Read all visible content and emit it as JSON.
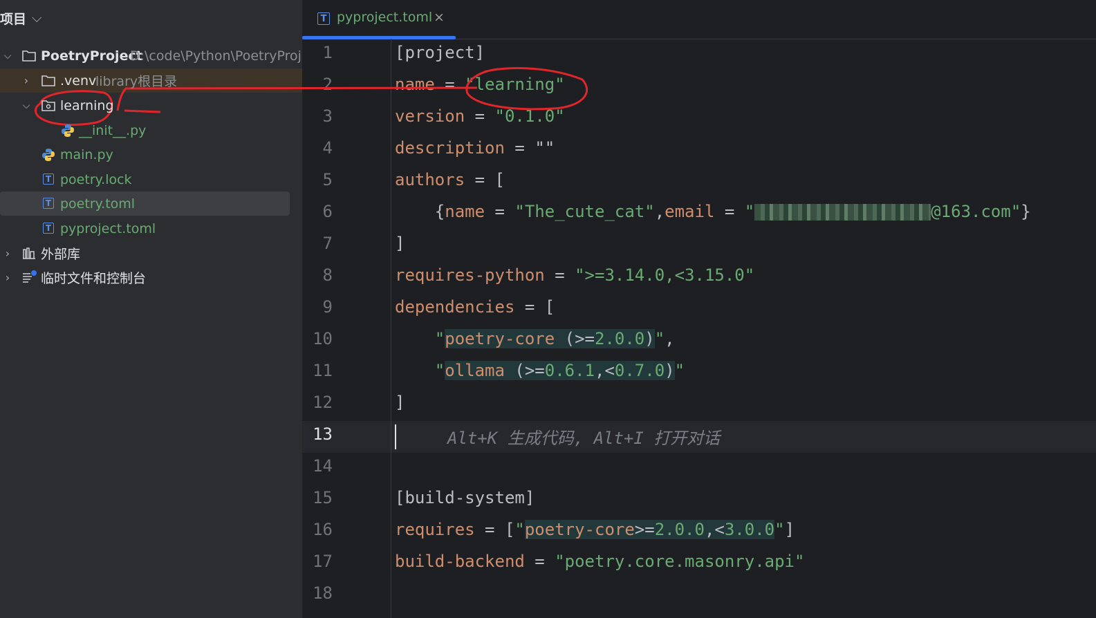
{
  "panel": {
    "title": "项目",
    "items": [
      {
        "label": "PoetryProject",
        "hint": "D:\\code\\Python\\PoetryProjec"
      },
      {
        "label": ".venv",
        "hint": "library根目录"
      },
      {
        "label": "learning"
      },
      {
        "label": "__init__.py"
      },
      {
        "label": "main.py"
      },
      {
        "label": "poetry.lock"
      },
      {
        "label": "poetry.toml"
      },
      {
        "label": "pyproject.toml"
      },
      {
        "label": "外部库"
      },
      {
        "label": "临时文件和控制台"
      }
    ]
  },
  "tab": {
    "label": "pyproject.toml",
    "close": "×"
  },
  "editor": {
    "line_numbers": [
      "1",
      "2",
      "3",
      "4",
      "5",
      "6",
      "7",
      "8",
      "9",
      "10",
      "11",
      "12",
      "13",
      "14",
      "15",
      "16",
      "17",
      "18"
    ],
    "active_line": "13",
    "lines": {
      "l1": {
        "a": "[project]"
      },
      "l2": {
        "k": "name",
        "op": " = ",
        "s": "\"learning\""
      },
      "l3": {
        "k": "version",
        "op": " = ",
        "s": "\"0.1.0\""
      },
      "l4": {
        "k": "description",
        "op": " = ",
        "s": "\"\""
      },
      "l5": {
        "k": "authors",
        "op": " = ["
      },
      "l6": {
        "p1": "    {",
        "k1": "name",
        "op1": " = ",
        "s1": "\"The_cute_cat\"",
        "p2": ",",
        "k2": "email",
        "op2": " = ",
        "s2a": "\"",
        "s2b": "@163.com\"",
        "p3": "}"
      },
      "l7": {
        "a": "]"
      },
      "l8": {
        "k": "requires-python",
        "op": " = ",
        "s": "\">=3.14.0,<3.15.0\""
      },
      "l9": {
        "k": "dependencies",
        "op": " = ["
      },
      "l10": {
        "p1": "    ",
        "q1": "\"",
        "k": "poetry-core",
        "t": " (>=",
        "n": "2.0.0",
        "t2": ")",
        "q2": "\"",
        "p2": ","
      },
      "l11": {
        "p1": "    ",
        "q1": "\"",
        "k": "ollama",
        "t": " (>=",
        "n": "0.6.1",
        "t3": ",<",
        "n2": "0.7.0",
        "t2": ")",
        "q2": "\""
      },
      "l12": {
        "a": "]"
      },
      "l13": {
        "ghost": "Alt+K 生成代码, Alt+I 打开对话"
      },
      "l15": {
        "a": "[build-system]"
      },
      "l16": {
        "k": "requires",
        "op": " = [",
        "q1": "\"",
        "k2": "poetry-core",
        "t": ">=",
        "n": "2.0.0",
        "t2": ",<",
        "n2": "3.0.0",
        "q2": "\"",
        "p": "]"
      },
      "l17": {
        "k": "build-backend",
        "op": " = ",
        "s": "\"poetry.core.masonry.api\""
      }
    }
  },
  "colors": {
    "accent": "#3574f0",
    "annotation": "#e0262b",
    "string": "#6aab73",
    "keyword": "#cf8e6d"
  }
}
